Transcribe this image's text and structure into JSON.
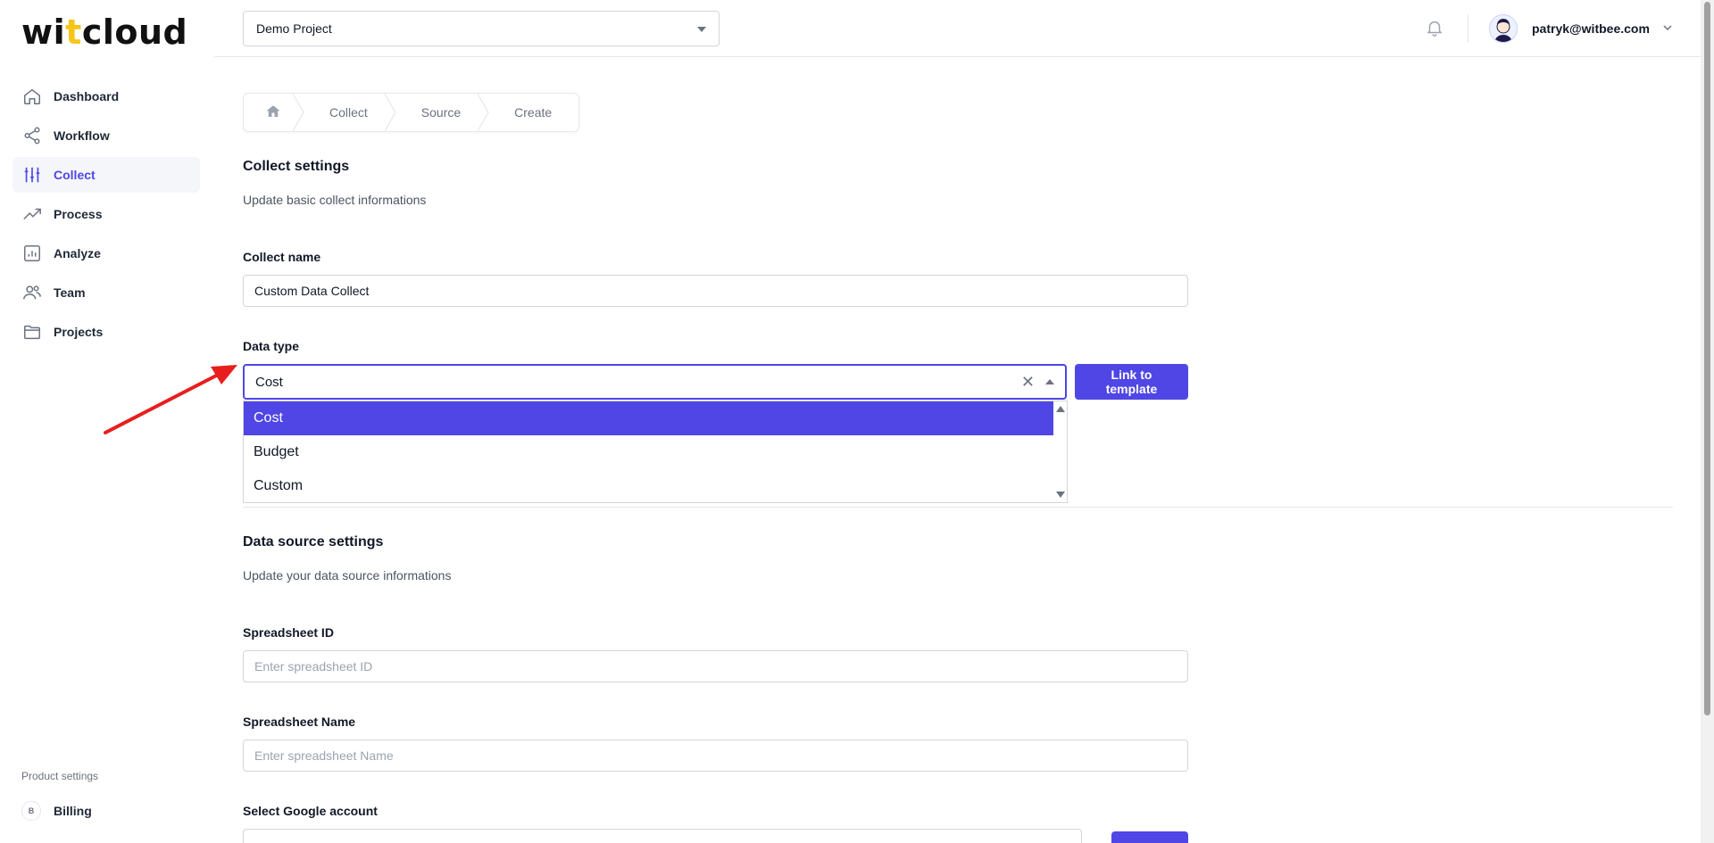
{
  "brand": {
    "logo_part1": "wi",
    "logo_dot": "t",
    "logo_part2": "cloud",
    "accent": "#4f46e5",
    "logo_dot_color": "#f5c518"
  },
  "sidebar": {
    "items": [
      {
        "label": "Dashboard",
        "icon": "home-icon",
        "active": false
      },
      {
        "label": "Workflow",
        "icon": "share-icon",
        "active": false
      },
      {
        "label": "Collect",
        "icon": "sliders-icon",
        "active": true
      },
      {
        "label": "Process",
        "icon": "trending-up-icon",
        "active": false
      },
      {
        "label": "Analyze",
        "icon": "bar-chart-icon",
        "active": false
      },
      {
        "label": "Team",
        "icon": "users-icon",
        "active": false
      },
      {
        "label": "Projects",
        "icon": "folder-icon",
        "active": false
      }
    ],
    "footer_label": "Product settings",
    "billing": {
      "badge": "B",
      "label": "Billing"
    }
  },
  "topbar": {
    "project": "Demo Project",
    "user_email": "patryk@witbee.com"
  },
  "breadcrumb": [
    "Collect",
    "Source",
    "Create"
  ],
  "collect_settings": {
    "title": "Collect settings",
    "description": "Update basic collect informations",
    "name_label": "Collect name",
    "name_value": "Custom Data Collect",
    "type_label": "Data type",
    "type_value": "Cost",
    "clear_symbol": "✕",
    "options": [
      "Cost",
      "Budget",
      "Custom"
    ],
    "link_button": "Link to template"
  },
  "data_source": {
    "title": "Data source settings",
    "description": "Update your data source informations",
    "spreadsheet_id_label": "Spreadsheet ID",
    "spreadsheet_id_placeholder": "Enter spreadsheet ID",
    "spreadsheet_name_label": "Spreadsheet Name",
    "spreadsheet_name_placeholder": "Enter spreadsheet Name",
    "google_account_label": "Select Google account"
  }
}
